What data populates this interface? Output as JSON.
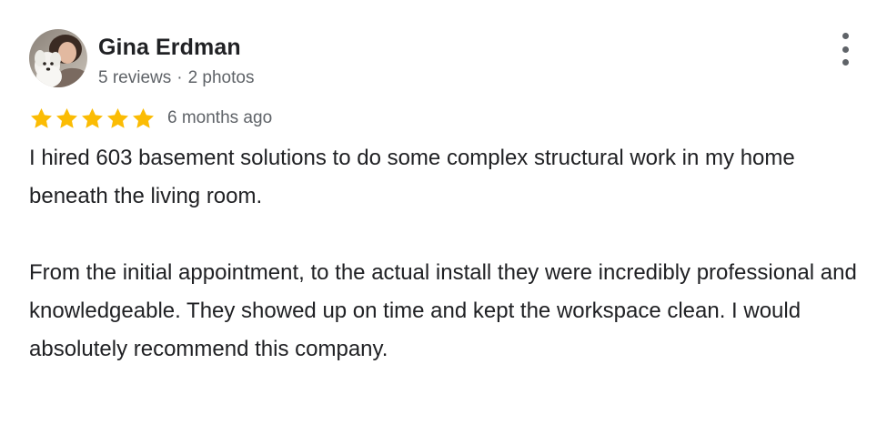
{
  "reviewer": {
    "name": "Gina Erdman",
    "reviews_count": "5 reviews",
    "separator": "·",
    "photos_count": "2 photos",
    "avatar": "person-with-white-dog-photo"
  },
  "menu": {
    "icon": "more-vert-icon"
  },
  "rating": {
    "stars": 5,
    "max_stars": 5,
    "star_color": "#FBBC04",
    "date": "6 months ago"
  },
  "review": {
    "paragraph_1": "I hired 603 basement solutions to do some complex structural work in my home beneath the living room.",
    "paragraph_2": "From the initial appointment, to the actual install they were incredibly professional and knowledgeable. They showed up on time and kept the workspace clean. I would absolutely recommend this company."
  }
}
